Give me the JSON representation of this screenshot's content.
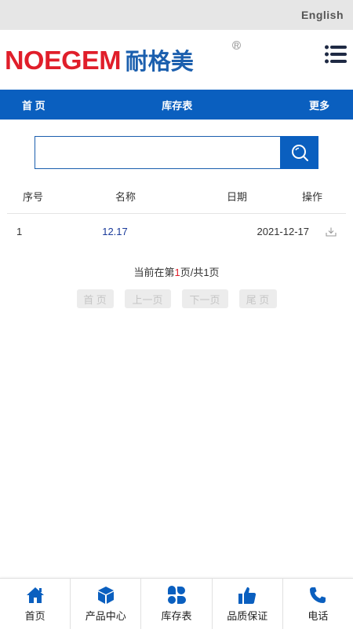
{
  "topbar": {
    "language_link": "English"
  },
  "header": {
    "logo_latin": "NOEGEM",
    "logo_cjk": "耐格美",
    "logo_reg_mark": "R"
  },
  "nav": {
    "items": [
      "首 页",
      "库存表",
      "更多"
    ]
  },
  "search": {
    "value": "",
    "placeholder": ""
  },
  "table": {
    "headers": [
      "序号",
      "名称",
      "日期",
      "操作"
    ],
    "rows": [
      {
        "no": "1",
        "name": "12.17",
        "date": "2021-12-17"
      }
    ]
  },
  "pager": {
    "prefix": "当前在第",
    "current": "1",
    "suffix": "页/共1页",
    "buttons": [
      "首 页",
      "上一页",
      "下一页",
      "尾 页"
    ]
  },
  "bottom_nav": {
    "items": [
      "首页",
      "产品中心",
      "库存表",
      "品质保证",
      "电话"
    ]
  },
  "colors": {
    "brand_blue": "#0a5fbf",
    "logo_red": "#e01e2a",
    "link_blue": "#1a3a9a"
  }
}
